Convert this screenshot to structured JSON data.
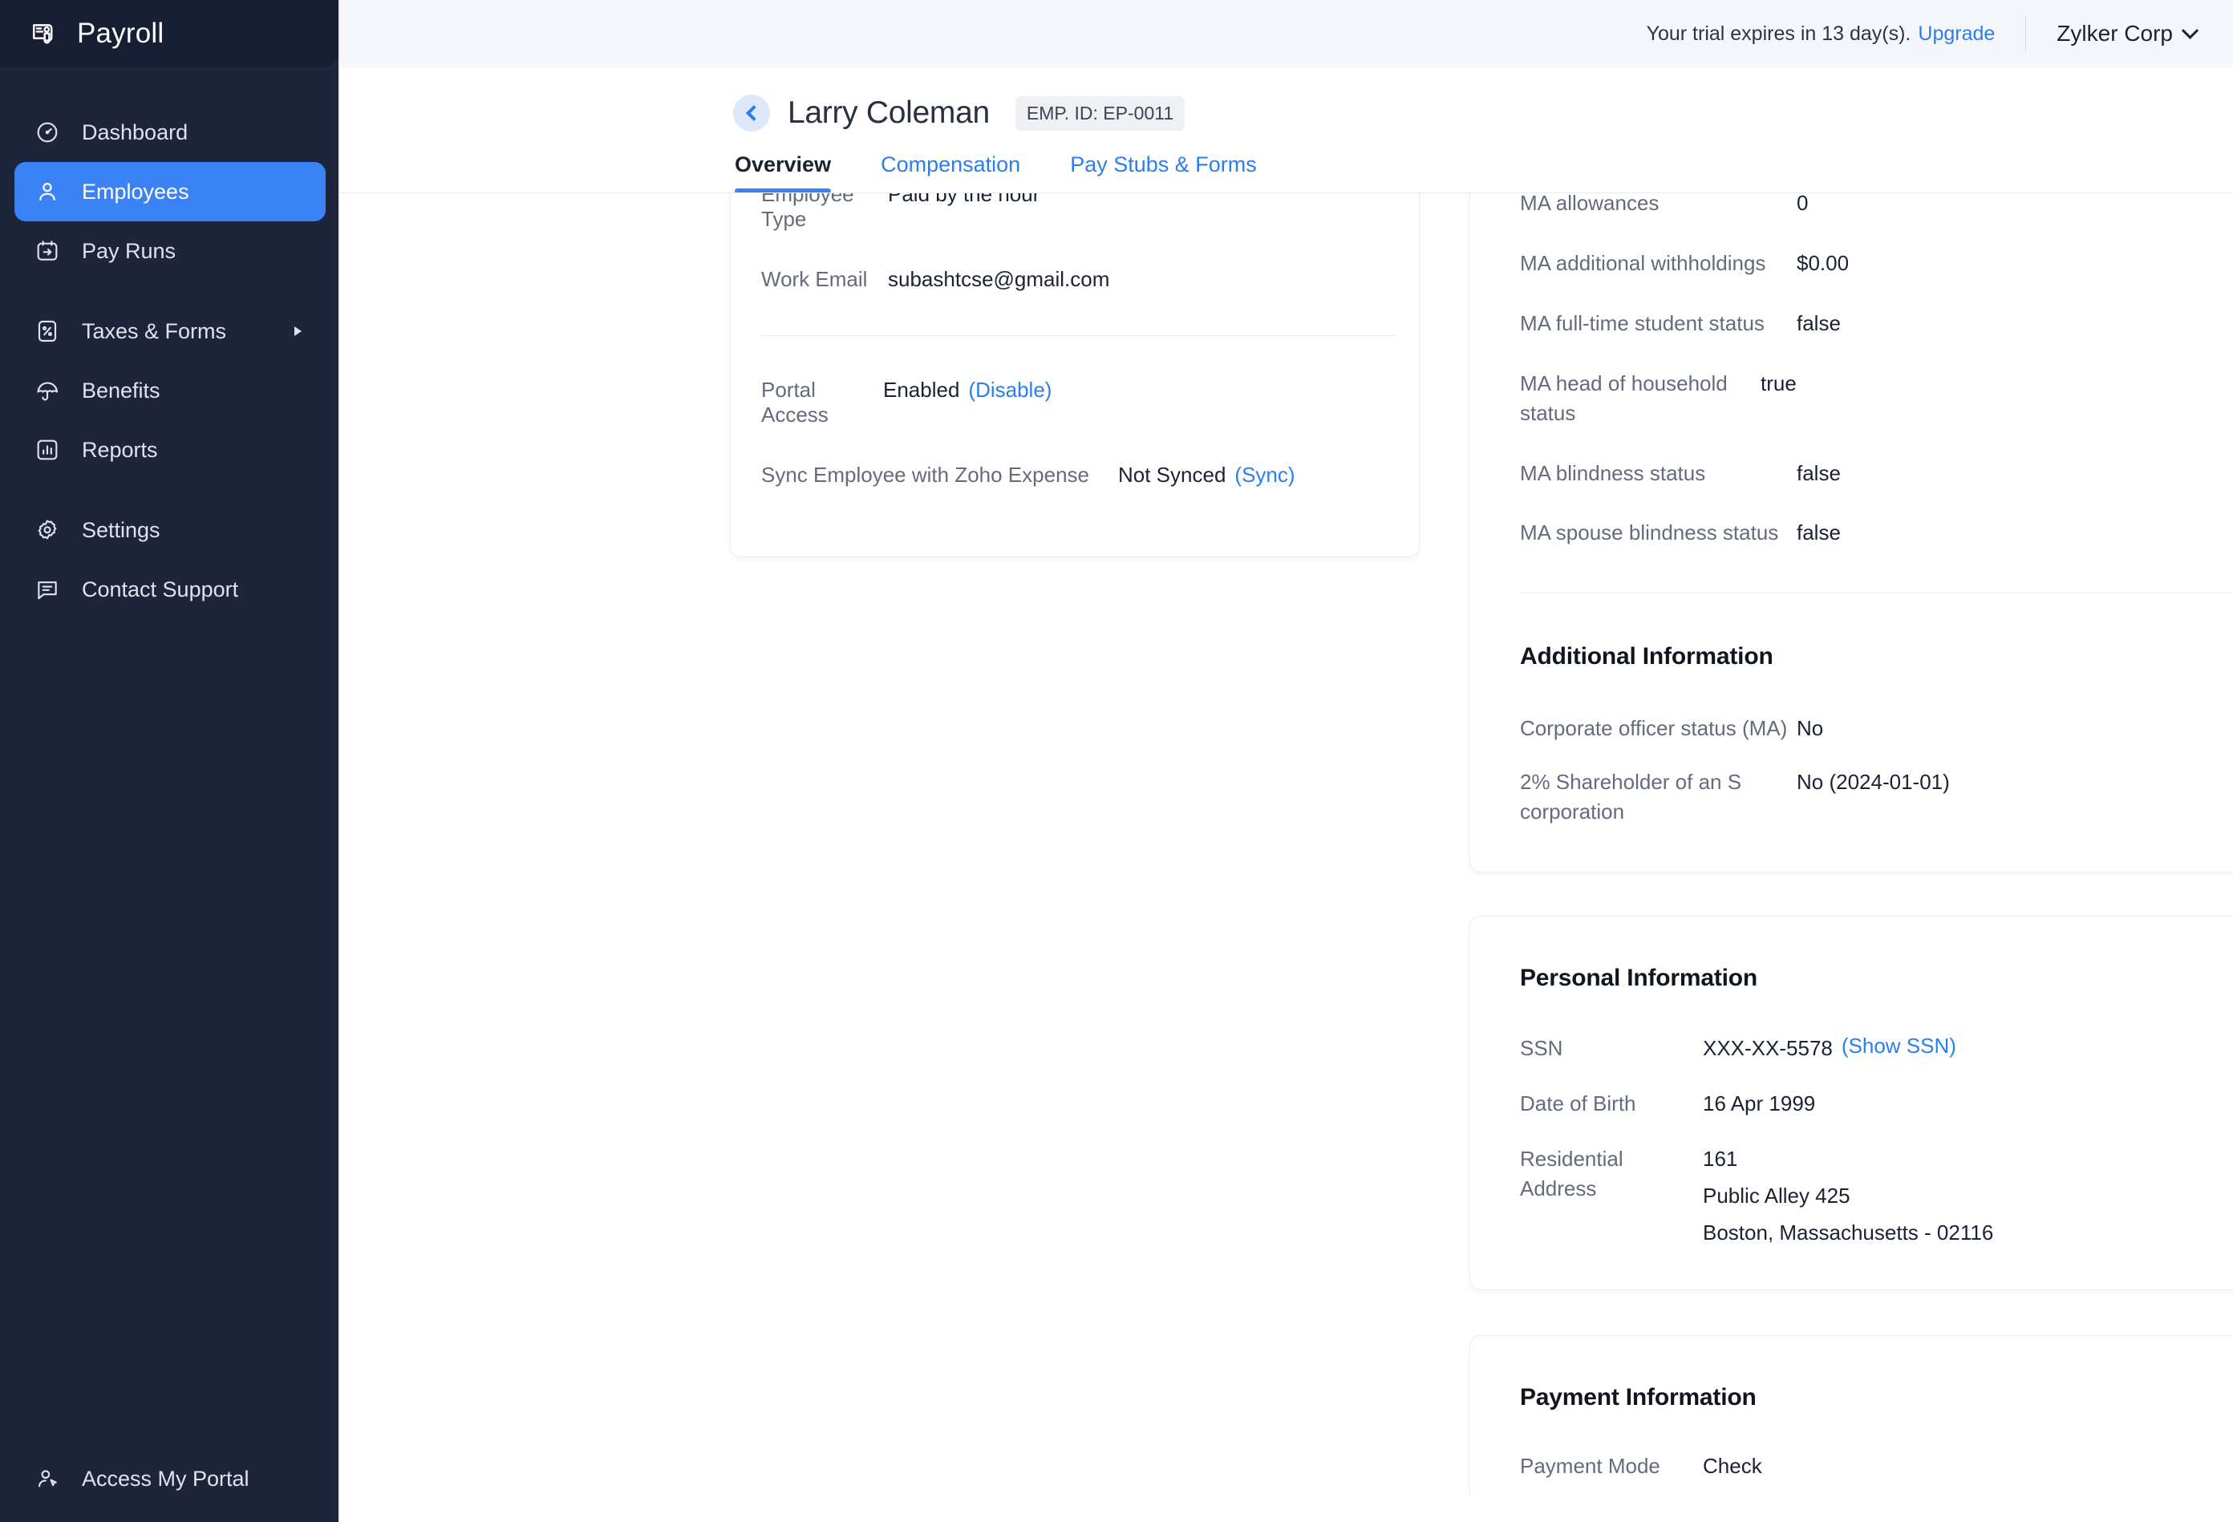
{
  "sidebar": {
    "brand": "Payroll",
    "items": [
      {
        "label": "Dashboard",
        "icon": "gauge-icon",
        "active": false
      },
      {
        "label": "Employees",
        "icon": "user-icon",
        "active": true
      },
      {
        "label": "Pay Runs",
        "icon": "calendar-arrow-icon",
        "active": false
      },
      {
        "label": "Taxes & Forms",
        "icon": "tax-document-icon",
        "active": false,
        "has_submenu": true
      },
      {
        "label": "Benefits",
        "icon": "umbrella-icon",
        "active": false
      },
      {
        "label": "Reports",
        "icon": "bar-chart-icon",
        "active": false
      },
      {
        "label": "Settings",
        "icon": "gear-icon",
        "active": false
      },
      {
        "label": "Contact Support",
        "icon": "chat-icon",
        "active": false
      }
    ],
    "footer": {
      "label": "Access My Portal",
      "icon": "user-cursor-icon"
    }
  },
  "topbar": {
    "trial_text": "Your trial expires in 13 day(s).",
    "upgrade_label": "Upgrade",
    "org_name": "Zylker Corp"
  },
  "page": {
    "employee_name": "Larry Coleman",
    "employee_id_badge": "EMP. ID: EP-0011",
    "back_icon": "chevron-left-icon",
    "tabs": [
      {
        "label": "Overview",
        "active": true
      },
      {
        "label": "Compensation",
        "active": false
      },
      {
        "label": "Pay Stubs & Forms",
        "active": false
      }
    ]
  },
  "left_card": {
    "rows_top": [
      {
        "label": "Employee Type",
        "value": "Paid by the hour"
      },
      {
        "label": "Work Email",
        "value": "subashtcse@gmail.com"
      }
    ],
    "rows_bottom": [
      {
        "label": "Portal Access",
        "value": "Enabled",
        "link": "(Disable)"
      },
      {
        "label": "Sync Employee with Zoho Expense",
        "value": "Not Synced",
        "link": "(Sync)"
      }
    ]
  },
  "tax_card": {
    "rows": [
      {
        "label": "MA allowances",
        "value": "0"
      },
      {
        "label": "MA additional withholdings",
        "value": "$0.00"
      },
      {
        "label": "MA full-time student status",
        "value": "false"
      },
      {
        "label": "MA head of household status",
        "value": "true"
      },
      {
        "label": "MA blindness status",
        "value": "false"
      },
      {
        "label": "MA spouse blindness status",
        "value": "false"
      }
    ]
  },
  "additional_info": {
    "title": "Additional Information",
    "edit_icon": "pencil-icon",
    "rows": [
      {
        "label": "Corporate officer status (MA)",
        "value": "No"
      },
      {
        "label": "2% Shareholder of an S corporation",
        "value": "No (2024-01-01)"
      }
    ]
  },
  "personal_info": {
    "title": "Personal Information",
    "edit_icon": "pencil-icon",
    "ssn_label": "SSN",
    "ssn_value": "XXX-XX-5578",
    "ssn_link": "(Show SSN)",
    "dob_label": "Date of Birth",
    "dob_value": "16 Apr 1999",
    "address_label": "Residential Address",
    "address_line1": "161",
    "address_line2": "Public Alley 425",
    "address_line3": "Boston,  Massachusetts - 02116"
  },
  "payment_info": {
    "title": "Payment Information",
    "edit_icon": "pencil-icon",
    "mode_label": "Payment Mode",
    "mode_value": "Check"
  },
  "colors": {
    "sidebar_bg": "#1e2439",
    "sidebar_brand_bg": "#191f33",
    "accent_blue": "#3b82f6",
    "link_blue": "#2a7ef0",
    "topbar_bg": "#f5f7fc",
    "highlight_pink": "#f50057"
  }
}
